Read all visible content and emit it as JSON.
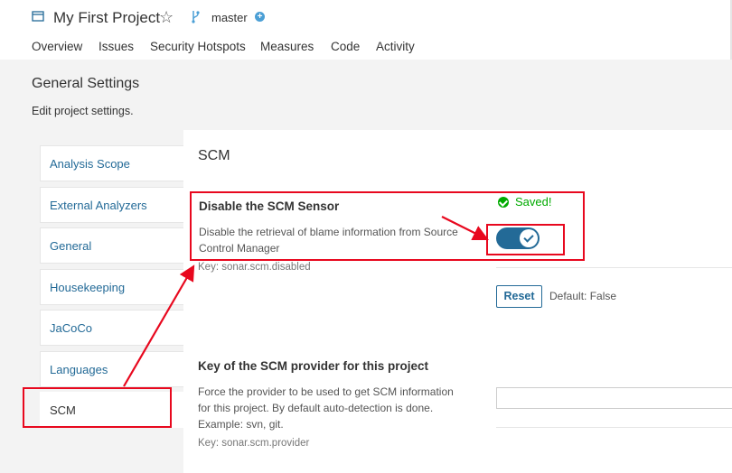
{
  "header": {
    "project_name": "My First Project",
    "branch": "master",
    "icons": {
      "project": "project-icon",
      "favorite": "star-icon",
      "branch": "branch-icon",
      "add": "plus-icon"
    }
  },
  "nav": {
    "tabs": [
      "Overview",
      "Issues",
      "Security Hotspots",
      "Measures",
      "Code",
      "Activity"
    ]
  },
  "page": {
    "title": "General Settings",
    "subtitle": "Edit project settings."
  },
  "sidebar": {
    "items": [
      "Analysis Scope",
      "External Analyzers",
      "General",
      "Housekeeping",
      "JaCoCo",
      "Languages",
      "SCM"
    ],
    "active": "SCM"
  },
  "section": {
    "title": "SCM"
  },
  "scm_disabled": {
    "name": "Disable the SCM Sensor",
    "description_line1": "Disable the retrieval of blame information from Source",
    "description_line2": "Control Manager",
    "key": "Key: sonar.scm.disabled",
    "status": "Saved!",
    "toggle_on": true,
    "reset_label": "Reset",
    "default_text": "Default: False"
  },
  "scm_provider": {
    "name": "Key of the SCM provider for this project",
    "description_line1": "Force the provider to be used to get SCM information",
    "description_line2": "for this project. By default auto-detection is done.",
    "description_line3": "Example: svn, git.",
    "key": "Key: sonar.scm.provider",
    "value": ""
  },
  "colors": {
    "accent": "#236a97",
    "annotation": "#e8081e",
    "success": "#00aa00",
    "page_bg": "#f3f3f3"
  }
}
